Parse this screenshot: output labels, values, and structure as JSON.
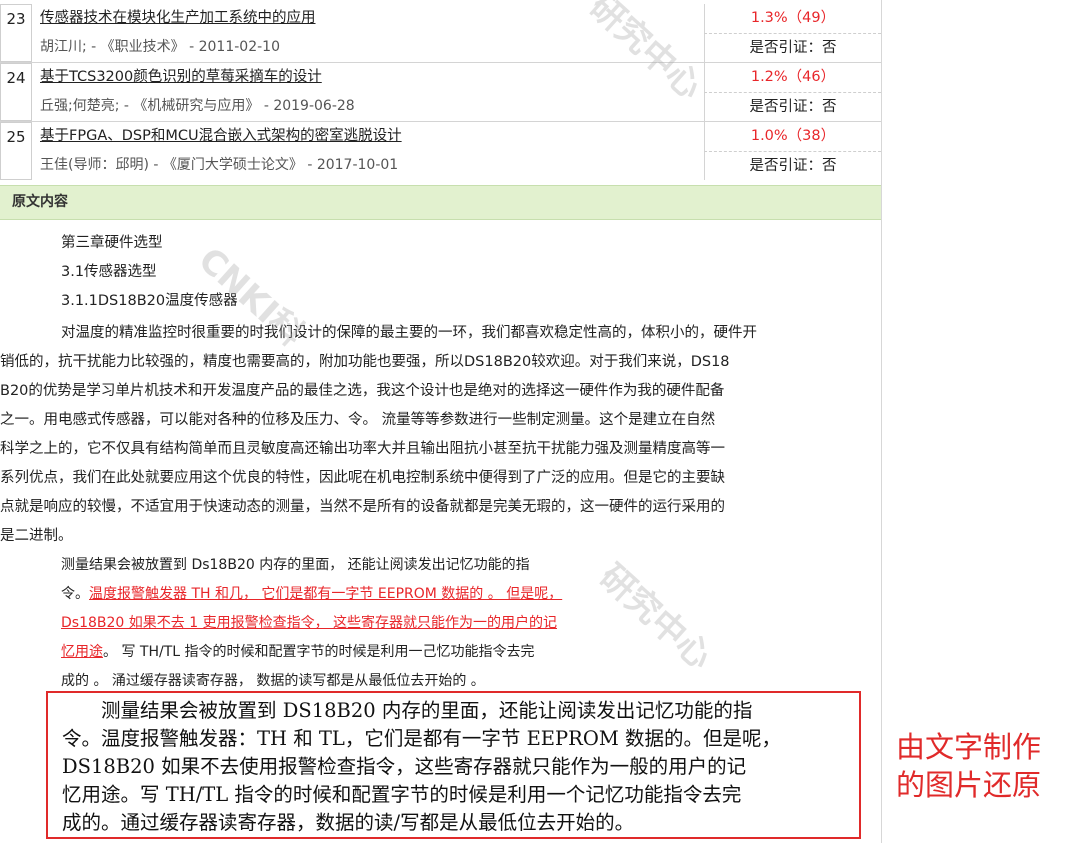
{
  "results": [
    {
      "num": "23",
      "title": "传感器技术在模块化生产加工系统中的应用",
      "author": "胡江川; - 《职业技术》 - 2011-02-10",
      "pct": "1.3%（49）",
      "cite": "是否引证：否"
    },
    {
      "num": "24",
      "title": "基于TCS3200颜色识别的草莓采摘车的设计",
      "author": "丘强;何楚亮; - 《机械研究与应用》 - 2019-06-28",
      "pct": "1.2%（46）",
      "cite": "是否引证：否"
    },
    {
      "num": "25",
      "title": "基于FPGA、DSP和MCU混合嵌入式架构的密室逃脱设计",
      "author": "王佳(导师：邱明) - 《厦门大学硕士论文》 - 2017-10-01",
      "pct": "1.0%（38）",
      "cite": "是否引证：否"
    }
  ],
  "section_title": "原文内容",
  "content": {
    "heading1": "第三章硬件选型",
    "heading2": "3.1传感器选型",
    "heading3": "3.1.1DS18B20温度传感器",
    "para_lines": [
      "对温度的精准监控时很重要的时我们设计的保障的最主要的一环，我们都喜欢稳定性高的，体积小的，硬件开",
      "销低的，抗干扰能力比较强的，精度也需要高的，附加功能也要强，所以DS18B20较欢迎。对于我们来说，DS18",
      "B20的优势是学习单片机技术和开发温度产品的最佳之选，我这个设计也是绝对的选择这一硬件作为我的硬件配备",
      "之一。用电感式传感器，可以能对各种的位移及压力、令。 流量等等参数进行一些制定测量。这个是建立在自然",
      "科学之上的，它不仅具有结构简单而且灵敏度高还输出功率大并且输出阻抗小甚至抗干扰能力强及测量精度高等一",
      "系列优点，我们在此处就要应用这个优良的特性，因此呢在机电控制系统中便得到了广泛的应用。但是它的主要缺",
      "点就是响应的较慢，不适宜用于快速动态的测量，当然不是所有的设备就都是完美无瑕的，这一硬件的运行采用的",
      "是二进制。"
    ],
    "ocr_line1": "测量结果会被放置到 Ds18B20 内存的里面， 还能让阅读发出记忆功能的指",
    "ocr_line2_prefix": "令。",
    "ocr_line2_red": "温度报警触发器 TH 和几， 它们是都有一字节 EEPROM 数据的 。 但是呢，",
    "ocr_line3_red": "Ds18B20 如果不去 1 吏用报警检查指令， 这些寄存器就只能作为一的用户的记",
    "ocr_line4_red": "忆用途",
    "ocr_line4_rest": "。 写 TH/TL 指令的时候和配置字节的时候是利用一己忆功能指令去完",
    "ocr_line5": "成的 。 涌过缓存器读寄存器， 数据的读写都是从最低位去开始的 。"
  },
  "restored_lines": [
    "　　测量结果会被放置到 DS18B20 内存的里面，还能让阅读发出记忆功能的指",
    "令。温度报警触发器：TH 和 TL，它们是都有一字节 EEPROM 数据的。但是呢，",
    "DS18B20 如果不去使用报警检查指令，这些寄存器就只能作为一般的用户的记",
    "忆用途。写 TH/TL 指令的时候和配置字节的时候是利用一个记忆功能指令去完",
    "成的。通过缓存器读寄存器，数据的读/写都是从最低位去开始的。"
  ],
  "caption_lines": [
    "由文字制作",
    "的图片还原"
  ],
  "watermarks": [
    "研究中心",
    "CNKI科",
    "研究中心"
  ],
  "colors": {
    "accent_red": "#e8262a",
    "section_bg": "#e2f1cf"
  }
}
